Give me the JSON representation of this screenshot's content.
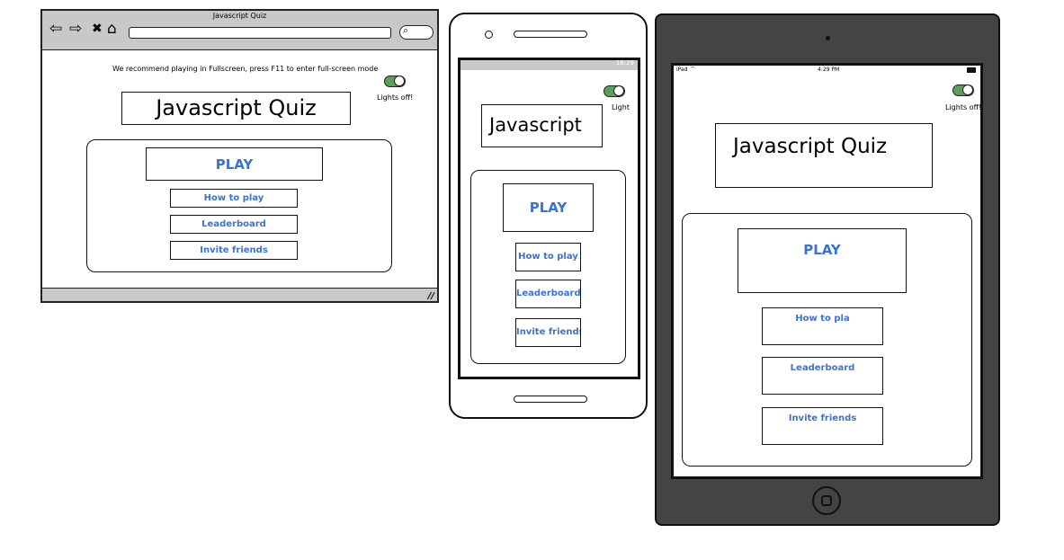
{
  "browser": {
    "window_title": "Javascript Quiz",
    "nav_icons": {
      "back": "⇦",
      "forward": "⇨",
      "stop": "✖",
      "home": "⌂",
      "search": "⌕"
    },
    "recommend_text": "We recommend playing in Fullscreen, press F11 to enter full-screen mode",
    "toggle_label": "Lights off!",
    "title": "Javascript Quiz",
    "play": "PLAY",
    "how_to_play": "How to play",
    "leaderboard": "Leaderboard",
    "invite": "Invite friends"
  },
  "phone": {
    "status_time": "18:29",
    "toggle_label": "Light",
    "title": "Javascript",
    "play": "PLAY",
    "how_to_play": "How to play",
    "leaderboard": "Leaderboard",
    "invite": "Invite friends"
  },
  "tablet": {
    "status_left": "iPad",
    "status_time": "4:29 PM",
    "toggle_label": "Lights off!",
    "title": "Javascript Quiz",
    "play": "PLAY",
    "how_to_play": "How to pla",
    "leaderboard": "Leaderboard",
    "invite": "Invite friends"
  },
  "colors": {
    "accent": "#3a73d1",
    "toggle_on": "#5aa05a",
    "chrome": "#c8c8c8",
    "tablet_body": "#444444"
  }
}
